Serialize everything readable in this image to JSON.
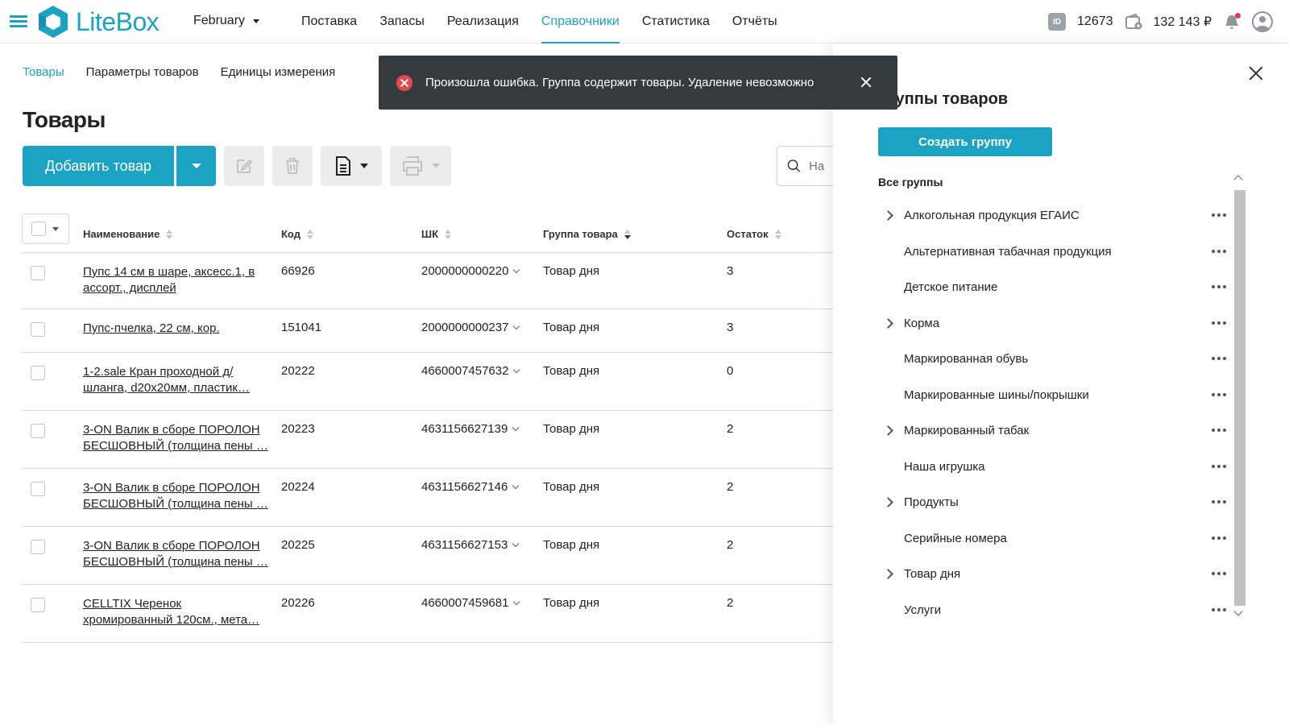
{
  "app": {
    "logo_text": "LiteBox",
    "period": "February",
    "accent": "#1ba3c4"
  },
  "nav": [
    "Поставка",
    "Запасы",
    "Реализация",
    "Справочники",
    "Статистика",
    "Отчёты"
  ],
  "nav_active": "Справочники",
  "header": {
    "id_label": "ID",
    "user_id": "12673",
    "balance": "132 143 ₽"
  },
  "subnav": [
    "Товары",
    "Параметры товаров",
    "Единицы измерения"
  ],
  "page_title": "Товары",
  "toolbar": {
    "add_label": "Добавить товар",
    "search_placeholder": "На"
  },
  "table": {
    "headers": [
      "Наименование",
      "Код",
      "ШК",
      "Группа товара",
      "Остаток"
    ],
    "rows": [
      {
        "name": "Пупс 14 см в шаре, аксесс.1, в ассорт., дисплей",
        "code": "66926",
        "barcode": "2000000000220",
        "group": "Товар дня",
        "stock": "3"
      },
      {
        "name": "Пупс-пчелка, 22 см, кор.",
        "code": "151041",
        "barcode": "2000000000237",
        "group": "Товар дня",
        "stock": "3"
      },
      {
        "name": "1-2.sale Кран проходной д/шланга, d20x20мм, пластик…",
        "code": "20222",
        "barcode": "4660007457632",
        "group": "Товар дня",
        "stock": "0"
      },
      {
        "name": "3-ON Валик в сборе ПОРОЛОН БЕСШОВНЫЙ (толщина пены …",
        "code": "20223",
        "barcode": "4631156627139",
        "group": "Товар дня",
        "stock": "2"
      },
      {
        "name": "3-ON Валик в сборе ПОРОЛОН БЕСШОВНЫЙ (толщина пены …",
        "code": "20224",
        "barcode": "4631156627146",
        "group": "Товар дня",
        "stock": "2"
      },
      {
        "name": "3-ON Валик в сборе ПОРОЛОН БЕСШОВНЫЙ (толщина пены …",
        "code": "20225",
        "barcode": "4631156627153",
        "group": "Товар дня",
        "stock": "2"
      },
      {
        "name": "CELLTIX Черенок хромированный 120см., мета…",
        "code": "20226",
        "barcode": "4660007459681",
        "group": "Товар дня",
        "stock": "2"
      }
    ]
  },
  "panel": {
    "title": "Группы товаров",
    "create_label": "Создать группу",
    "all_groups": "Все группы",
    "groups": [
      {
        "label": "Алкогольная продукция ЕГАИС",
        "expandable": true
      },
      {
        "label": "Альтернативная табачная продукция",
        "expandable": false
      },
      {
        "label": "Детское питание",
        "expandable": false
      },
      {
        "label": "Корма",
        "expandable": true
      },
      {
        "label": "Маркированная обувь",
        "expandable": false
      },
      {
        "label": "Маркированные шины/покрышки",
        "expandable": false
      },
      {
        "label": "Маркированный табак",
        "expandable": true
      },
      {
        "label": "Наша игрушка",
        "expandable": false
      },
      {
        "label": "Продукты",
        "expandable": true
      },
      {
        "label": "Серийные номера",
        "expandable": false
      },
      {
        "label": "Товар дня",
        "expandable": true
      },
      {
        "label": "Услуги",
        "expandable": false
      }
    ]
  },
  "toast": {
    "message": "Произошла ошибка. Группа содержит товары. Удаление невозможно",
    "color": "#333b40",
    "icon": "error-icon"
  }
}
